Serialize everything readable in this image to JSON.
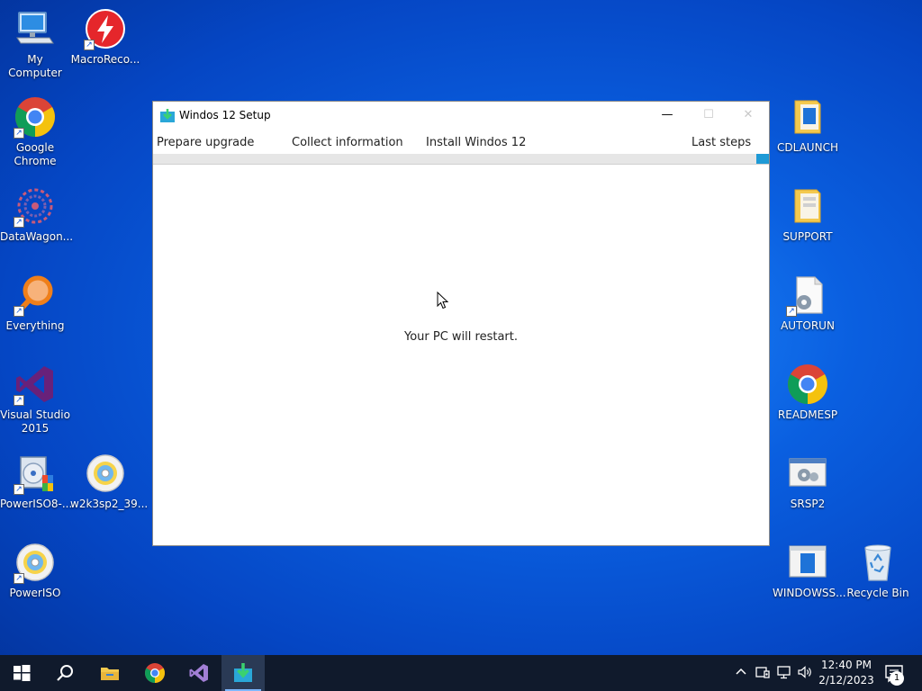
{
  "desktop": {
    "left_icons": [
      {
        "label": "My Computer",
        "icon": "computer-icon"
      },
      {
        "label": "MacroReco...",
        "icon": "macro-recorder-icon"
      },
      {
        "label": "Google Chrome",
        "icon": "chrome-icon"
      },
      {
        "label": "DataWagon...",
        "icon": "datawagon-icon"
      },
      {
        "label": "Everything",
        "icon": "everything-search-icon"
      },
      {
        "label": "Visual Studio 2015",
        "icon": "visual-studio-icon"
      },
      {
        "label": "PowerISO8-...",
        "icon": "poweriso-installer-icon"
      },
      {
        "label": "w2k3sp2_39...",
        "icon": "disc-image-icon"
      },
      {
        "label": "PowerISO",
        "icon": "poweriso-icon"
      }
    ],
    "right_icons": [
      {
        "label": "CDLAUNCH",
        "icon": "folder-icon"
      },
      {
        "label": "SUPPORT",
        "icon": "folder-icon"
      },
      {
        "label": "AUTORUN",
        "icon": "settings-file-icon"
      },
      {
        "label": "READMESP",
        "icon": "chrome-icon"
      },
      {
        "label": "SRSP2",
        "icon": "settings-window-icon"
      },
      {
        "label": "WINDOWSS...",
        "icon": "window-app-icon"
      },
      {
        "label": "Recycle Bin",
        "icon": "recycle-bin-icon"
      }
    ]
  },
  "setup_window": {
    "title": "Windos 12 Setup",
    "controls": {
      "minimize": "—",
      "maximize": "☐",
      "close": "✕"
    },
    "steps": [
      "Prepare upgrade",
      "Collect information",
      "Install Windos 12",
      "Last steps"
    ],
    "progress_fraction": 0.98,
    "message": "Your PC will restart."
  },
  "taskbar": {
    "items": [
      "start-icon",
      "search-icon",
      "file-explorer-icon",
      "chrome-icon",
      "visual-studio-icon",
      "setup-icon"
    ],
    "active_item": "setup-icon",
    "clock_time": "12:40 PM",
    "clock_date": "2/12/2023",
    "notification_count": "1",
    "colors": {
      "accent": "#1e9ad6",
      "taskbar": "#101a2c",
      "desktop": "#0a5fe0"
    }
  }
}
